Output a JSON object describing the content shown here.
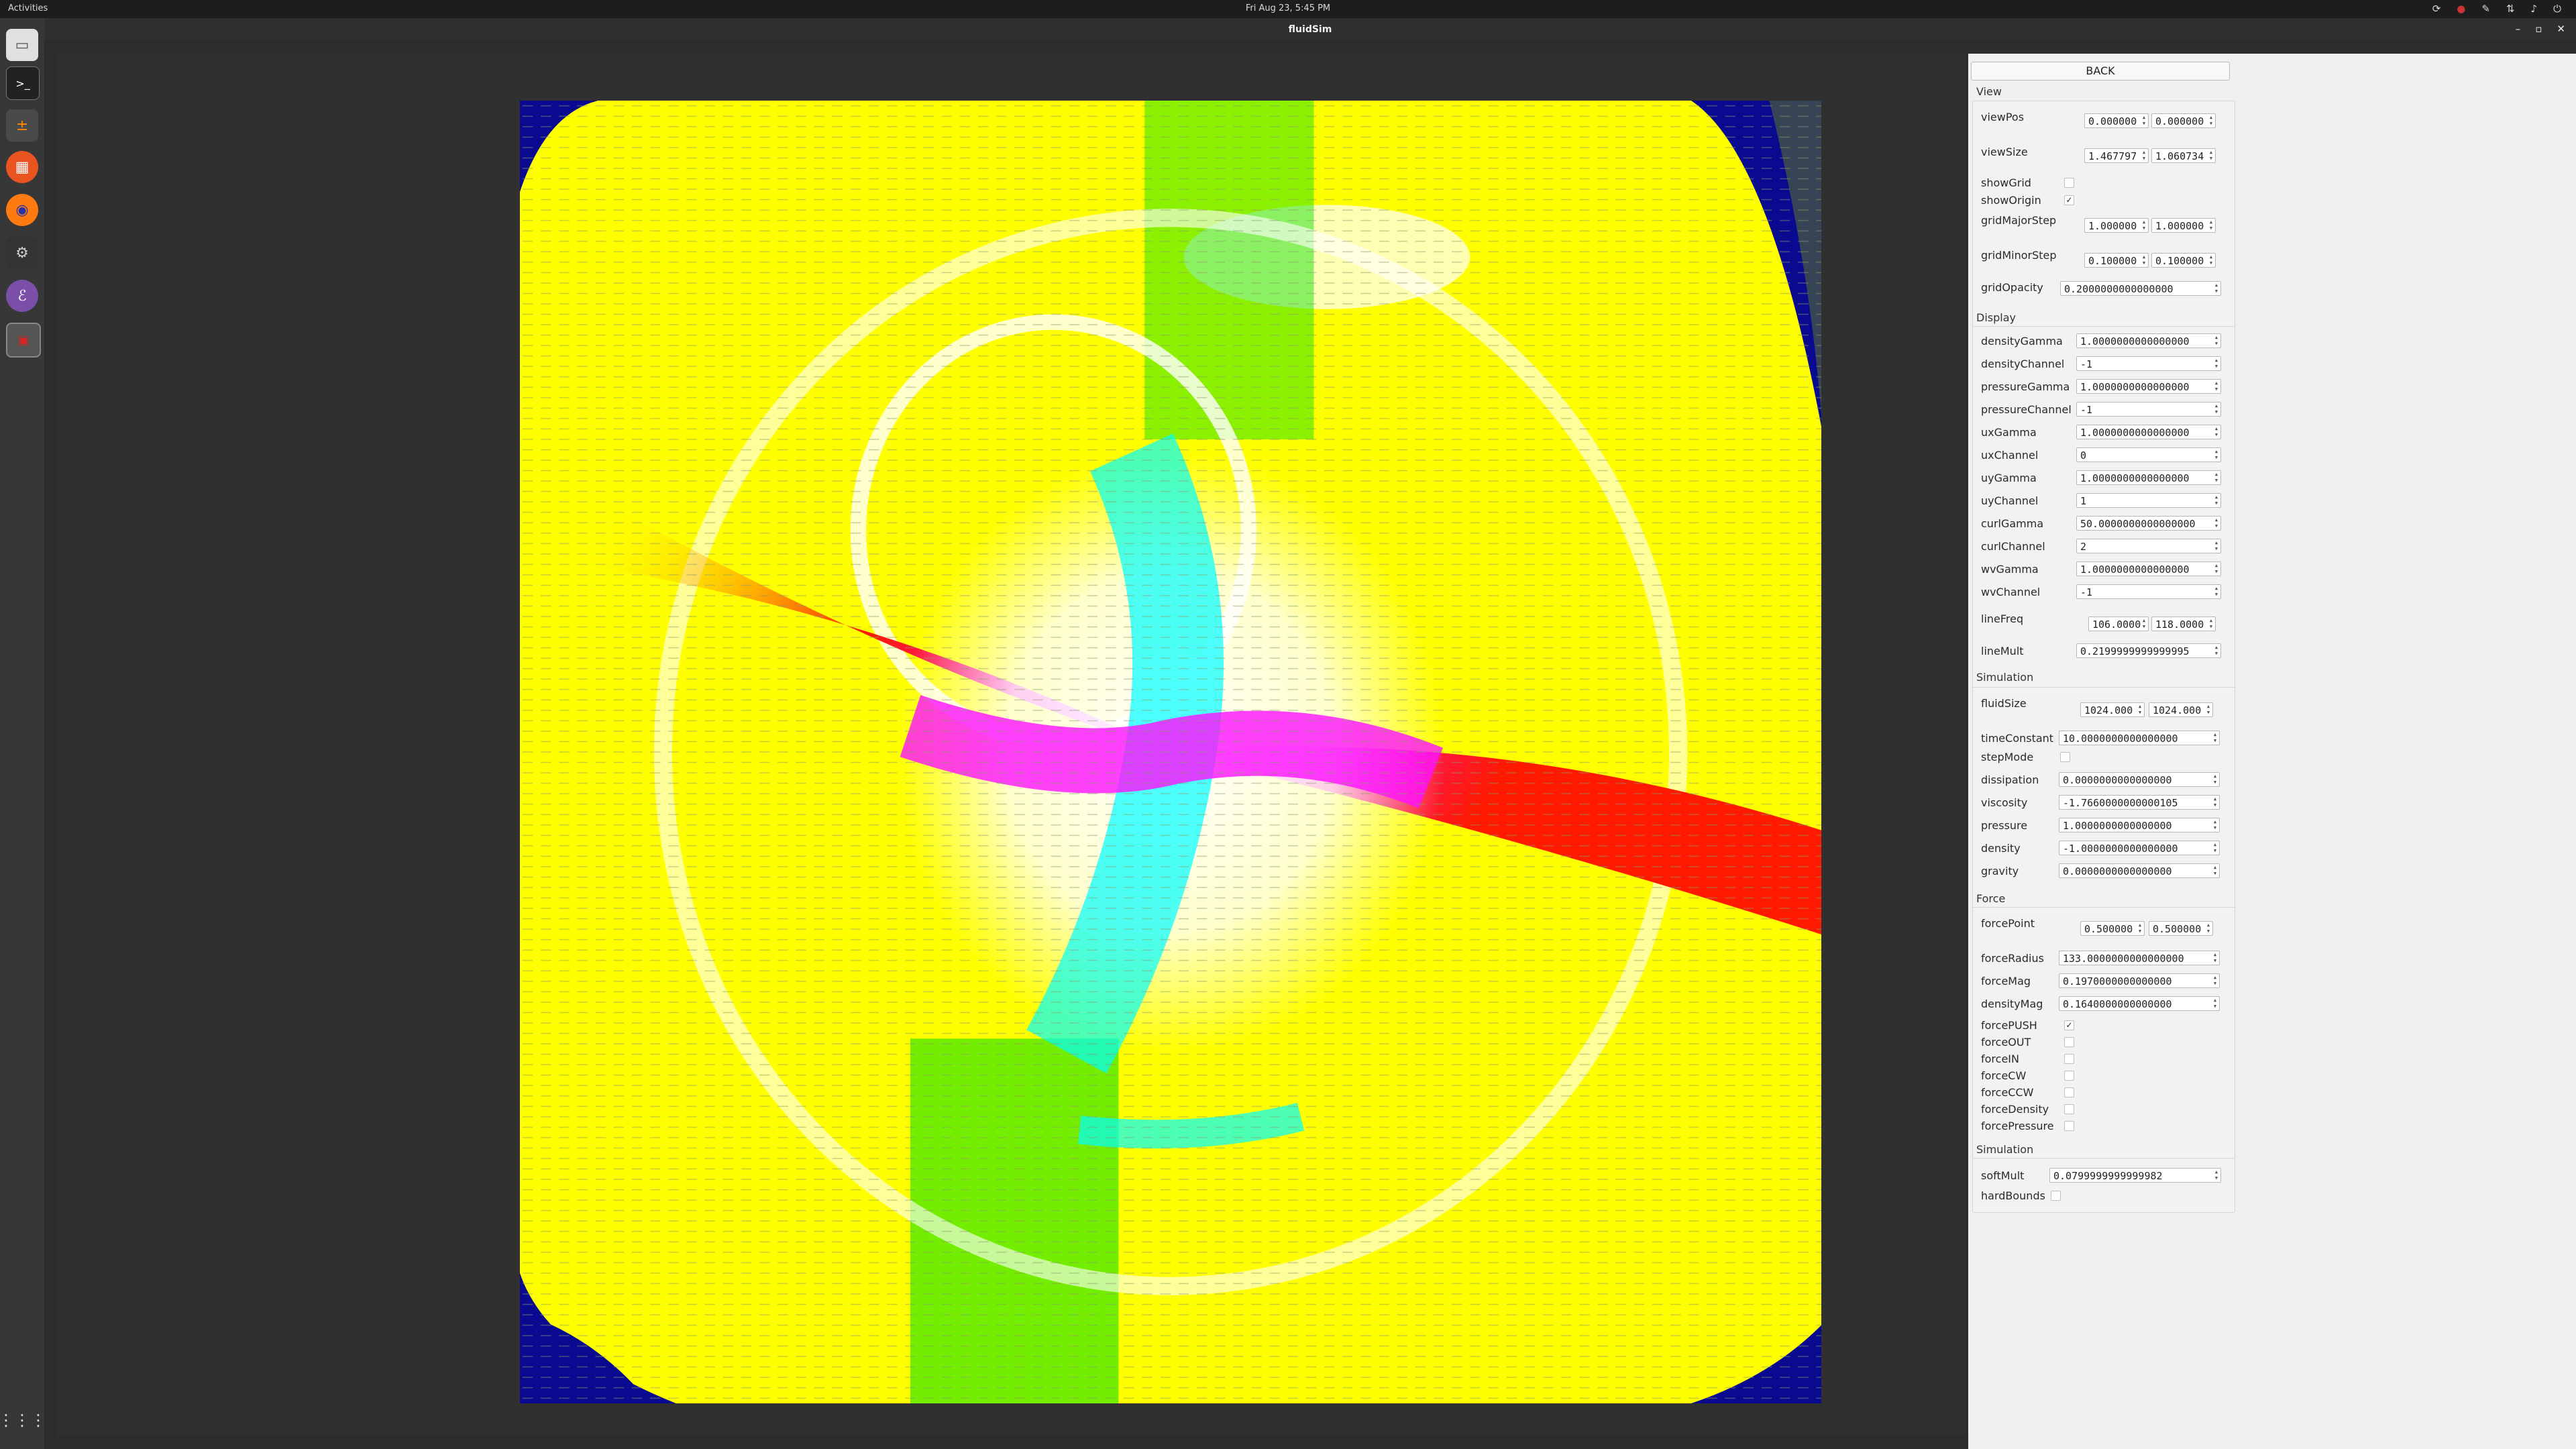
{
  "topbar": {
    "activities": "Activities",
    "clock": "Fri Aug 23,  5:45 PM"
  },
  "window": {
    "title": "fluidSim"
  },
  "panel": {
    "back": "BACK",
    "view": {
      "header": "View",
      "viewPos": {
        "label": "viewPos",
        "x": "0.000000",
        "y": "0.000000"
      },
      "viewSize": {
        "label": "viewSize",
        "x": "1.467797",
        "y": "1.060734"
      },
      "showGrid": {
        "label": "showGrid",
        "checked": false
      },
      "showOrigin": {
        "label": "showOrigin",
        "checked": true
      },
      "gridMajorStep": {
        "label": "gridMajorStep",
        "x": "1.000000",
        "y": "1.000000"
      },
      "gridMinorStep": {
        "label": "gridMinorStep",
        "x": "0.100000",
        "y": "0.100000"
      },
      "gridOpacity": {
        "label": "gridOpacity",
        "value": "0.2000000000000000"
      }
    },
    "display": {
      "header": "Display",
      "fields": [
        {
          "label": "densityGamma",
          "value": "1.0000000000000000"
        },
        {
          "label": "densityChannel",
          "value": "-1"
        },
        {
          "label": "pressureGamma",
          "value": "1.0000000000000000"
        },
        {
          "label": "pressureChannel",
          "value": "-1"
        },
        {
          "label": "uxGamma",
          "value": "1.0000000000000000"
        },
        {
          "label": "uxChannel",
          "value": "0"
        },
        {
          "label": "uyGamma",
          "value": "1.0000000000000000"
        },
        {
          "label": "uyChannel",
          "value": "1"
        },
        {
          "label": "curlGamma",
          "value": "50.0000000000000000"
        },
        {
          "label": "curlChannel",
          "value": "2"
        },
        {
          "label": "wvGamma",
          "value": "1.0000000000000000"
        },
        {
          "label": "wvChannel",
          "value": "-1"
        }
      ],
      "lineFreq": {
        "label": "lineFreq",
        "x": "106.0000",
        "y": "118.0000"
      },
      "lineMult": {
        "label": "lineMult",
        "value": "0.2199999999999995"
      }
    },
    "simulation": {
      "header": "Simulation",
      "fluidSize": {
        "label": "fluidSize",
        "x": "1024.000",
        "y": "1024.000"
      },
      "timeConstant": {
        "label": "timeConstant",
        "value": "10.0000000000000000"
      },
      "stepMode": {
        "label": "stepMode",
        "checked": false
      },
      "fields": [
        {
          "label": "dissipation",
          "value": "0.0000000000000000"
        },
        {
          "label": "viscosity",
          "value": "-1.7660000000000105"
        },
        {
          "label": "pressure",
          "value": "1.0000000000000000"
        },
        {
          "label": "density",
          "value": "-1.0000000000000000"
        },
        {
          "label": "gravity",
          "value": "0.0000000000000000"
        }
      ]
    },
    "force": {
      "header": "Force",
      "forcePoint": {
        "label": "forcePoint",
        "x": "0.500000",
        "y": "0.500000"
      },
      "fields": [
        {
          "label": "forceRadius",
          "value": "133.0000000000000000"
        },
        {
          "label": "forceMag",
          "value": "0.1970000000000000"
        },
        {
          "label": "densityMag",
          "value": "0.1640000000000000"
        }
      ],
      "checks": [
        {
          "label": "forcePUSH",
          "checked": true
        },
        {
          "label": "forceOUT",
          "checked": false
        },
        {
          "label": "forceIN",
          "checked": false
        },
        {
          "label": "forceCW",
          "checked": false
        },
        {
          "label": "forceCCW",
          "checked": false
        },
        {
          "label": "forceDensity",
          "checked": false
        },
        {
          "label": "forcePressure",
          "checked": false
        }
      ]
    },
    "simulation2": {
      "header": "Simulation",
      "softMult": {
        "label": "softMult",
        "value": "0.0799999999999982"
      },
      "hardBounds": {
        "label": "hardBounds",
        "checked": false
      }
    }
  },
  "colors": {
    "yellow": "#ffff00",
    "red": "#ff1a00",
    "magenta": "#ff10ff",
    "cyan": "#00ffff",
    "green": "#00e000",
    "blue": "#0a0a90"
  }
}
